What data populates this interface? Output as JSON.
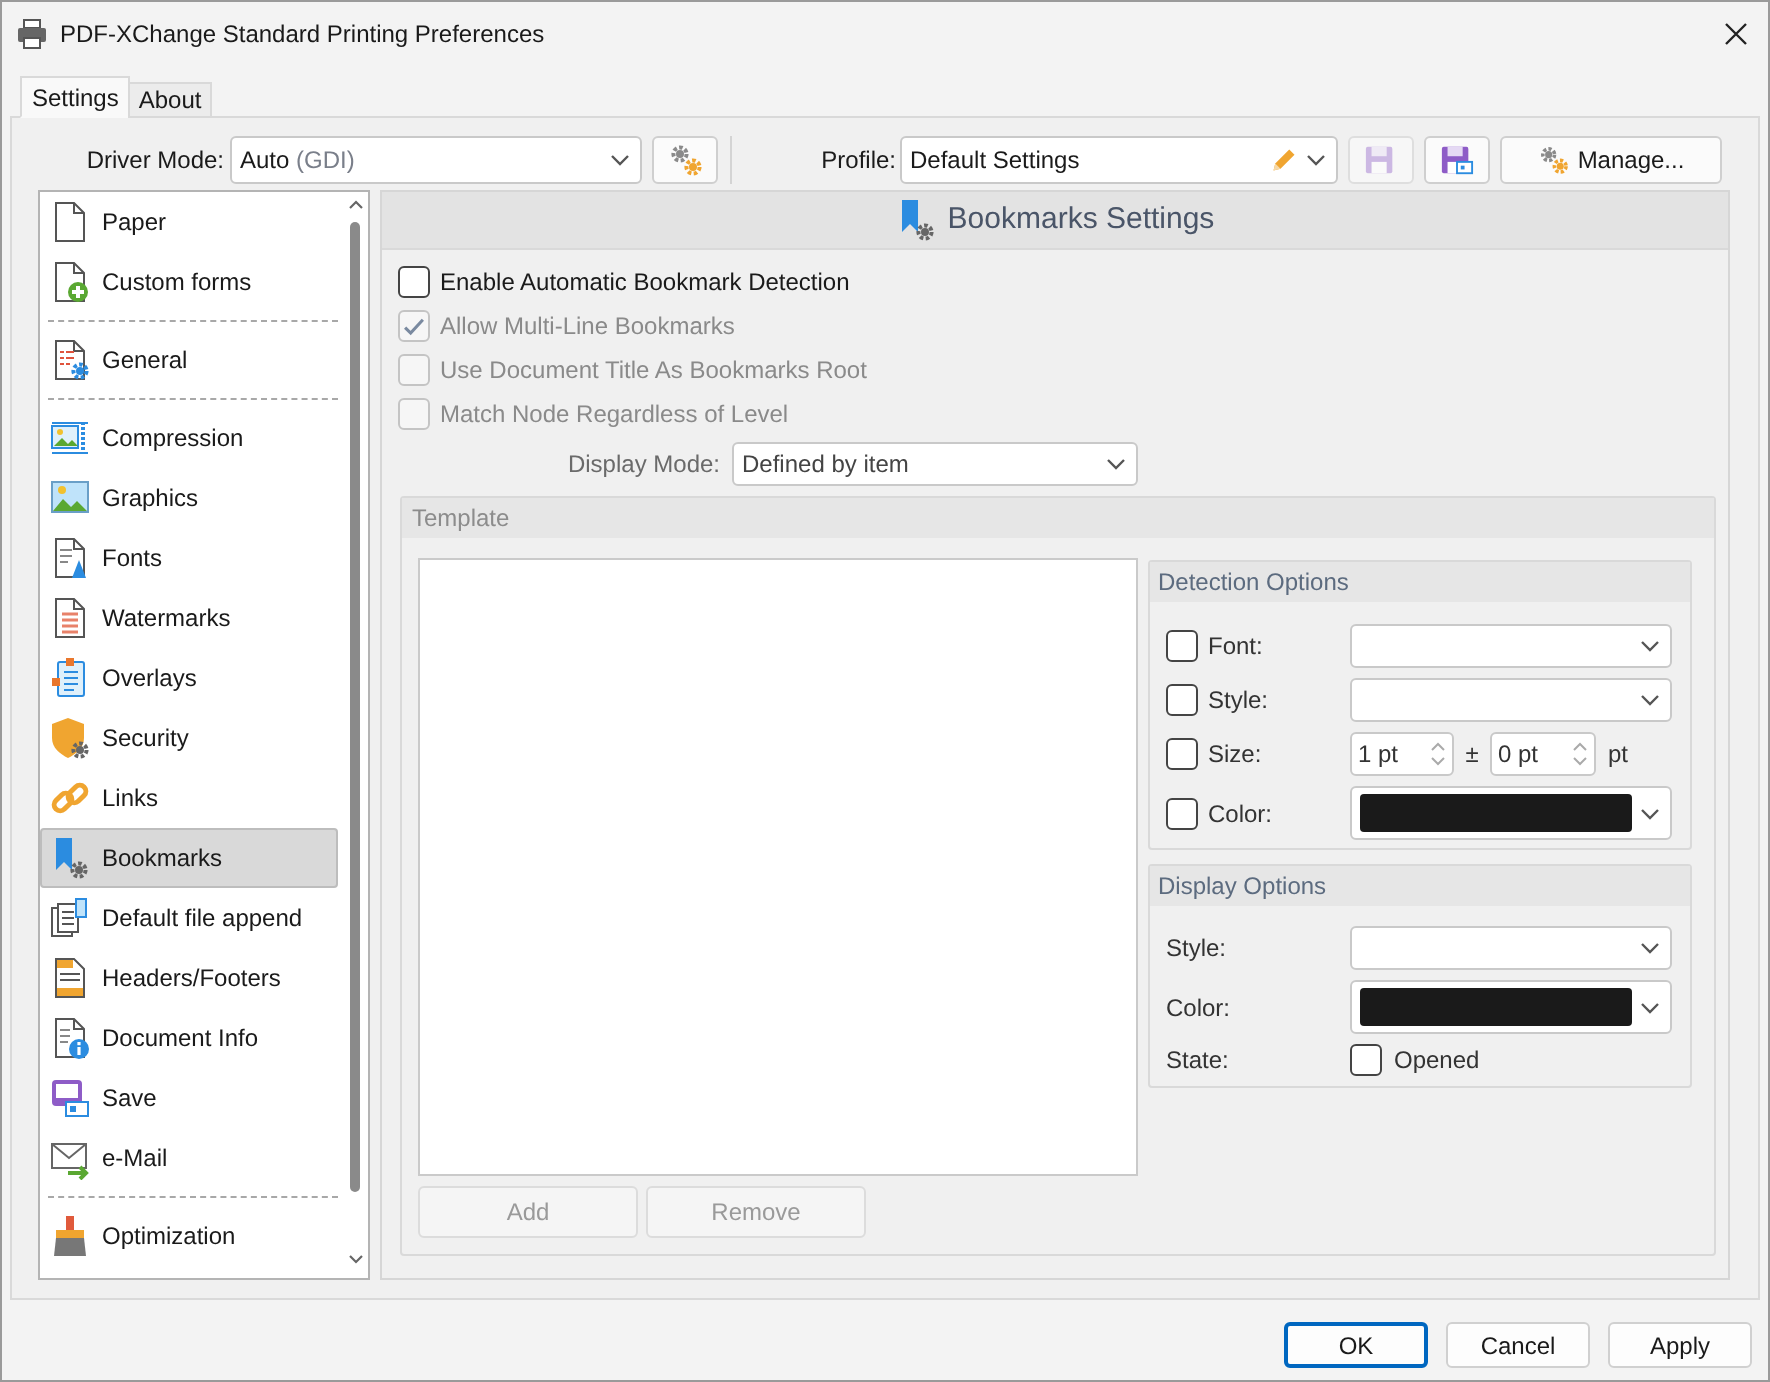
{
  "window": {
    "title": "PDF-XChange Standard Printing Preferences"
  },
  "tabs": [
    {
      "label": "Settings",
      "selected": true
    },
    {
      "label": "About",
      "selected": false
    }
  ],
  "toolbar": {
    "driver_mode": {
      "label": "Driver Mode:",
      "value": "Auto",
      "note": "(GDI)"
    },
    "profile": {
      "label": "Profile:",
      "value": "Default Settings"
    },
    "save_buttons": [
      {
        "disabled": true
      },
      {
        "disabled": false
      }
    ],
    "manage_button": "Manage..."
  },
  "sidebar": {
    "groups": [
      {
        "items": [
          {
            "label": "Paper",
            "selected": false
          },
          {
            "label": "Custom forms",
            "selected": false
          }
        ]
      },
      {
        "items": [
          {
            "label": "General",
            "selected": false
          }
        ]
      },
      {
        "items": [
          {
            "label": "Compression",
            "selected": false
          },
          {
            "label": "Graphics",
            "selected": false
          },
          {
            "label": "Fonts",
            "selected": false
          },
          {
            "label": "Watermarks",
            "selected": false
          },
          {
            "label": "Overlays",
            "selected": false
          },
          {
            "label": "Security",
            "selected": false
          },
          {
            "label": "Links",
            "selected": false
          },
          {
            "label": "Bookmarks",
            "selected": true
          },
          {
            "label": "Default file append",
            "selected": false
          },
          {
            "label": "Headers/Footers",
            "selected": false
          },
          {
            "label": "Document Info",
            "selected": false
          },
          {
            "label": "Save",
            "selected": false
          },
          {
            "label": "e-Mail",
            "selected": false
          }
        ]
      },
      {
        "items": [
          {
            "label": "Optimization",
            "selected": false
          }
        ]
      }
    ]
  },
  "panel": {
    "title": "Bookmarks Settings",
    "options": [
      {
        "label": "Enable Automatic Bookmark Detection",
        "checked": false,
        "disabled": false
      },
      {
        "label": "Allow Multi-Line Bookmarks",
        "checked": true,
        "disabled": true
      },
      {
        "label": "Use Document Title As Bookmarks Root",
        "checked": false,
        "disabled": true
      },
      {
        "label": "Match Node Regardless of Level",
        "checked": false,
        "disabled": true
      }
    ],
    "display_mode": {
      "label": "Display Mode:",
      "value": "Defined by item"
    },
    "template": {
      "title": "Template",
      "disabled": true,
      "buttons": [
        {
          "label": "Add",
          "disabled": true
        },
        {
          "label": "Remove",
          "disabled": true
        }
      ],
      "detection_options": {
        "title": "Detection Options",
        "rows": [
          {
            "kind": "dropdown",
            "label": "Font:",
            "checked": false
          },
          {
            "kind": "dropdown",
            "label": "Style:",
            "checked": false
          },
          {
            "kind": "size",
            "label": "Size:",
            "checked": false,
            "value": "1 pt",
            "tolerance_sign": "±",
            "tolerance": "0 pt",
            "unit": "pt"
          },
          {
            "kind": "color",
            "label": "Color:",
            "checked": false,
            "color": "#1a1a1a"
          }
        ]
      },
      "display_options": {
        "title": "Display Options",
        "rows": [
          {
            "kind": "dropdown",
            "label": "Style:"
          },
          {
            "kind": "color",
            "label": "Color:",
            "color": "#1a1a1a"
          },
          {
            "kind": "checkbox",
            "label": "State:",
            "option": "Opened",
            "checked": false
          }
        ]
      }
    }
  },
  "footer": {
    "buttons": [
      {
        "label": "OK",
        "default": true
      },
      {
        "label": "Cancel",
        "default": false
      },
      {
        "label": "Apply",
        "default": false
      }
    ]
  }
}
